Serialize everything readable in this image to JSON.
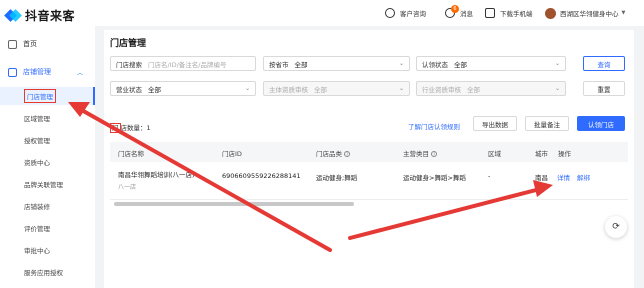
{
  "brand": {
    "name": "抖音来客"
  },
  "sidebar": {
    "home": "首页",
    "group": "店铺管理",
    "items": [
      "门店管理",
      "区域管理",
      "授权管理",
      "资质中心",
      "品牌关联管理",
      "店铺装修",
      "评价管理",
      "审批中心",
      "服务应用授权"
    ]
  },
  "topbar": {
    "service": "客户咨询",
    "messages": "消息",
    "messages_badge": "6",
    "download": "下载手机端",
    "account": "西湖区华翎健身中心"
  },
  "page": {
    "title": "门店管理"
  },
  "filters": {
    "search_label": "门店搜索",
    "search_placeholder": "门店名/ID/备注名/品牌编号",
    "region_label": "按省市",
    "region_value": "全部",
    "cert_label": "认领状态",
    "cert_value": "全部",
    "biz_label": "营业状态",
    "biz_value": "全部",
    "main_qual_label": "主体资质审核",
    "main_qual_value": "全部",
    "ind_qual_label": "行业资质审核",
    "ind_qual_value": "全部",
    "query_btn": "查询",
    "reset_btn": "重置"
  },
  "actions": {
    "learn_link": "了解门店认领规则",
    "export": "导出数据",
    "batch_note": "批量备注",
    "claim": "认领门店"
  },
  "count_label_a": "门",
  "count_label_b": "店数量：1",
  "table": {
    "headers": [
      "门店名称",
      "门店ID",
      "门店品类",
      "主营类目",
      "区域",
      "城市",
      "操作"
    ],
    "rows": [
      {
        "name": "南昌华翎舞蹈培训(八一店)",
        "branch": "八一店",
        "id": "6906609559226288141",
        "category": "运动健身;舞蹈",
        "main_cat": "运动健身>舞蹈>舞蹈",
        "area": "-",
        "city": "南昌",
        "op_detail": "详情",
        "op_unbind": "解绑"
      }
    ]
  },
  "colors": {
    "accent": "#2f6bff",
    "annotation": "#e53935"
  }
}
